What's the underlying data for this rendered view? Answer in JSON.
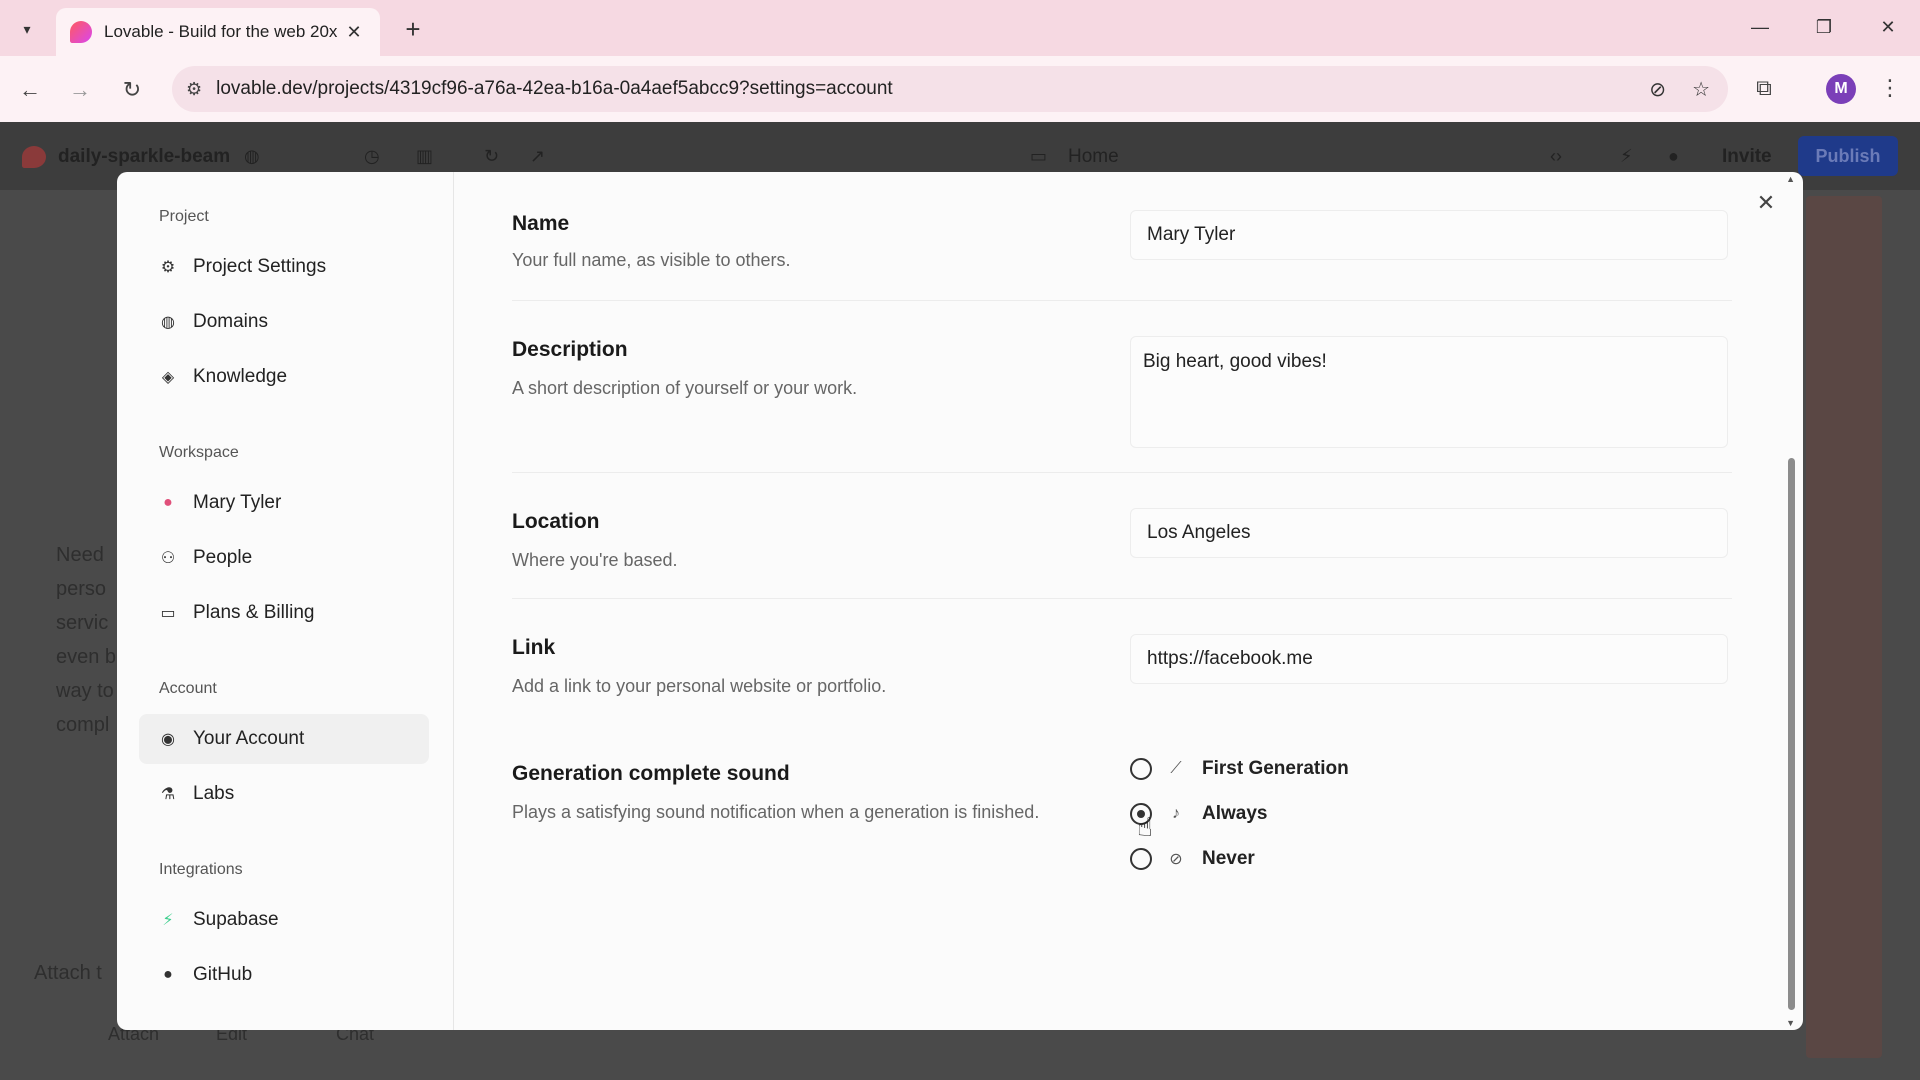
{
  "browser": {
    "tab_title": "Lovable - Build for the web 20x",
    "url": "lovable.dev/projects/4319cf96-a76a-42ea-b16a-0a4aef5abcc9?settings=account",
    "profile_initial": "M"
  },
  "app": {
    "project_name": "daily-sparkle-beam",
    "home_label": "Home",
    "invite_label": "Invite",
    "publish_label": "Publish"
  },
  "sidebar": {
    "sections": [
      {
        "title": "Project",
        "items": [
          {
            "label": "Project Settings",
            "icon": "gear-icon"
          },
          {
            "label": "Domains",
            "icon": "globe-icon"
          },
          {
            "label": "Knowledge",
            "icon": "graduation-cap-icon"
          }
        ]
      },
      {
        "title": "Workspace",
        "items": [
          {
            "label": "Mary Tyler",
            "icon": "workspace-avatar-icon"
          },
          {
            "label": "People",
            "icon": "users-icon"
          },
          {
            "label": "Plans & Billing",
            "icon": "credit-card-icon"
          }
        ]
      },
      {
        "title": "Account",
        "items": [
          {
            "label": "Your Account",
            "icon": "user-circle-icon",
            "active": true
          },
          {
            "label": "Labs",
            "icon": "flask-icon"
          }
        ]
      },
      {
        "title": "Integrations",
        "items": [
          {
            "label": "Supabase",
            "icon": "supabase-icon"
          },
          {
            "label": "GitHub",
            "icon": "github-icon"
          }
        ]
      }
    ]
  },
  "account": {
    "name": {
      "label": "Name",
      "description": "Your full name, as visible to others.",
      "value": "Mary Tyler"
    },
    "description": {
      "label": "Description",
      "description": "A short description of yourself or your work.",
      "value": "Big heart, good vibes!"
    },
    "location": {
      "label": "Location",
      "description": "Where you're based.",
      "value": "Los Angeles"
    },
    "link": {
      "label": "Link",
      "description": "Add a link to your personal website or portfolio.",
      "value": "https://facebook.me"
    },
    "sound": {
      "label": "Generation complete sound",
      "description": "Plays a satisfying sound notification when a generation is finished.",
      "options": [
        {
          "label": "First Generation",
          "icon": "trend-icon",
          "selected": false
        },
        {
          "label": "Always",
          "icon": "volume-icon",
          "selected": true
        },
        {
          "label": "Never",
          "icon": "volume-mute-icon",
          "selected": false
        }
      ]
    }
  },
  "background_text": {
    "lines": [
      "Need",
      "perso",
      "servic",
      "even b",
      "way to",
      "compl"
    ],
    "attach": "Attach",
    "edit": "Edit",
    "chat": "Chat",
    "attach_note": "Attach t"
  },
  "colors": {
    "accent": "#1f3a8a",
    "tab_bg": "#f6d9e2",
    "supabase": "#3ecf8e"
  }
}
